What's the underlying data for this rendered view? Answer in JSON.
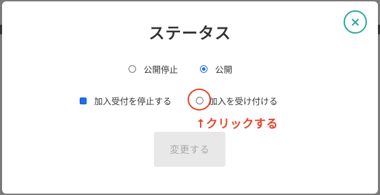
{
  "modal": {
    "title": "ステータス",
    "close_icon": "close-icon",
    "close_symbol": "×"
  },
  "publish_options": [
    {
      "label": "公開停止",
      "selected": false
    },
    {
      "label": "公開",
      "selected": true
    }
  ],
  "join_options": [
    {
      "label": "加入受付を停止する",
      "selected": true
    },
    {
      "label": "加入を受け付ける",
      "selected": false
    }
  ],
  "annotation": {
    "text": "↑クリックする",
    "color": "#e8442a"
  },
  "submit": {
    "label": "変更する"
  },
  "colors": {
    "accent": "#28a79a",
    "radio_selected": "#1a73e8"
  }
}
